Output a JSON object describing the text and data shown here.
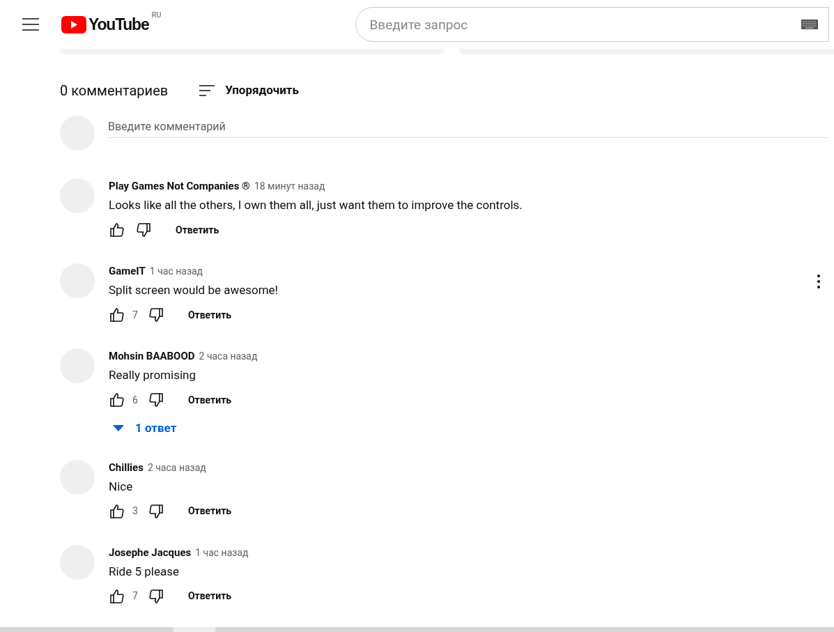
{
  "header": {
    "logo_text": "YouTube",
    "region": "RU",
    "search": {
      "placeholder": "Введите запрос"
    }
  },
  "comments_header": {
    "count": "0 комментариев",
    "sort": "Упорядочить"
  },
  "comment_input": {
    "placeholder": "Введите комментарий"
  },
  "comments": [
    {
      "author": "Play Games Not Companies ®",
      "time": "18 минут назад",
      "text": "Looks like all the others, I own them all, just want them to improve the controls.",
      "reply": "Ответить",
      "menu_shown": false
    },
    {
      "author": "GameIT",
      "time": "1 час назад",
      "text": "Split screen would be awesome!",
      "likes": "7",
      "reply": "Ответить",
      "menu_shown": true
    },
    {
      "author": "Mohsin BAABOOD",
      "time": "2 часа назад",
      "text": "Really promising",
      "likes": "6",
      "reply": "Ответить",
      "menu_shown": false,
      "replies_toggle": "1 ответ"
    },
    {
      "author": "Chillies",
      "time": "2 часа назад",
      "text": "Nice",
      "likes": "3",
      "reply": "Ответить",
      "menu_shown": false
    },
    {
      "author": "Josephe Jacques",
      "time": "1 час назад",
      "text": "Ride 5 please",
      "likes": "7",
      "reply": "Ответить",
      "menu_shown": false
    }
  ]
}
